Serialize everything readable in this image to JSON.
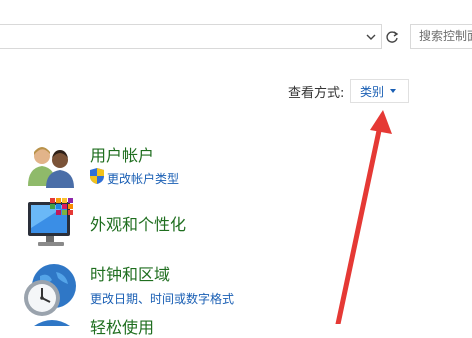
{
  "toolbar": {
    "search_placeholder": "搜索控制面板"
  },
  "view_by": {
    "label": "查看方式:",
    "selected": "类别"
  },
  "categories": [
    {
      "title": "用户帐户",
      "link": "更改帐户类型"
    },
    {
      "title": "外观和个性化"
    },
    {
      "title": "时钟和区域",
      "link": "更改日期、时间或数字格式"
    },
    {
      "title": "轻松使用"
    }
  ],
  "colors": {
    "category_title": "#1f6e1f",
    "link": "#1a5fb4",
    "annotation_arrow": "#e53935"
  }
}
